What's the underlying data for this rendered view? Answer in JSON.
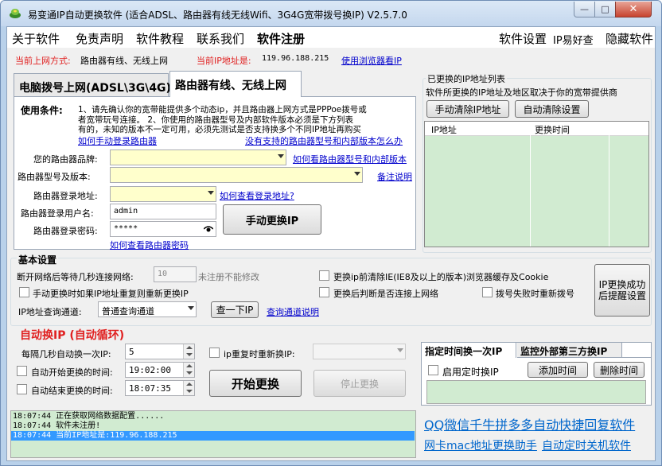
{
  "window": {
    "title": "易变通IP自动更换软件 (适合ADSL、路由器有线无线Wifi、3G4G宽带拨号换IP) V2.5.7.0",
    "min": "—",
    "max": "□",
    "close": "✕"
  },
  "menu": {
    "left": [
      "关于软件",
      "免责声明",
      "软件教程",
      "联系我们",
      "软件注册"
    ],
    "right": [
      "软件设置",
      "IP易好查",
      "隐藏软件"
    ]
  },
  "status": {
    "mode_label": "当前上网方式:",
    "mode_value": "路由器有线、无线上网",
    "ip_label": "当前IP地址是:",
    "ip_value": "119.96.188.215",
    "browser_link": "使用浏览器看IP"
  },
  "tabs": [
    "电脑拨号上网(ADSL\\3G\\4G)",
    "路由器有线、无线上网"
  ],
  "router": {
    "cond_title": "使用条件:",
    "cond_text1": "1、请先确认你的宽带能提供多个动态ip，并且路由器上网方式是PPPoe拨号或",
    "cond_text2": "者宽带玩号连接。  2、你使用的路由器型号及内部软件版本必须是下方列表",
    "cond_text3": "有的，未知的版本不一定可用，必须先测试是否支持换多个不同IP地址再购买",
    "link_login": "如何手动登录路由器",
    "link_unsupported": "没有支持的路由器型号和内部版本怎么办",
    "brand_label": "您的路由器品牌:",
    "brand_link": "如何看路由器型号和内部版本",
    "model_label": "路由器型号及版本:",
    "model_link": "备注说明",
    "addr_label": "路由器登录地址:",
    "addr_link": "如何查看登录地址?",
    "user_label": "路由器登录用户名:",
    "user_value": "admin",
    "pwd_label": "路由器登录密码:",
    "pwd_value": "*****",
    "pwd_link": "如何查看路由器密码",
    "manual_btn": "手动更换IP"
  },
  "iplist": {
    "title": "已更换的IP地址列表",
    "desc": "软件所更换的IP地址及地区取决于你的宽带提供商",
    "clear_btn": "手动清除IP地址",
    "auto_clear_btn": "自动清除设置",
    "col_ip": "IP地址",
    "col_time": "更换时间"
  },
  "basic": {
    "title": "基本设置",
    "reconnect_label": "断开网络后等待几秒连接网络:",
    "reconnect_value": "10",
    "reconnect_note": "未注册不能修改",
    "clear_cache": "更换ip前清除IE(IE8及以上的版本)浏览器缓存及Cookie",
    "dup_check": "手动更换时如果IP地址重复则重新更换IP",
    "check_conn": "更换后判断是否连接上网络",
    "redial": "拨号失败时重新拨号",
    "query_label": "IP地址查询通道:",
    "query_value": "普通查询通道",
    "query_btn": "查一下IP",
    "query_link": "查询通道说明",
    "notify_btn_line1": "IP更换成功",
    "notify_btn_line2": "后提醒设置"
  },
  "auto": {
    "title": "自动换IP (自动循环)",
    "interval_label": "每隔几秒自动换一次IP:",
    "interval_value": "5",
    "repeat_label": "ip重复时重新换IP:",
    "start_label": "自动开始更换的时间:",
    "start_value": "19:02:00",
    "end_label": "自动结束更换的时间:",
    "end_value": "18:07:35",
    "start_btn": "开始更换",
    "stop_btn": "停止更换"
  },
  "schedule": {
    "tabs": [
      "指定时间换一次IP",
      "监控外部第三方换IP"
    ],
    "enable_label": "启用定时换IP",
    "add_btn": "添加时间",
    "del_btn": "删除时间"
  },
  "log": [
    "18:07:44 正在获取网络数据配置......",
    "18:07:44 软件未注册!",
    "18:07:44 当前IP地址是:119.96.188.215"
  ],
  "ads": {
    "ad1": "QQ微信千牛拼多多自动快捷回复软件",
    "ad2": "网卡mac地址更换助手",
    "ad3": "自动定时关机软件"
  }
}
